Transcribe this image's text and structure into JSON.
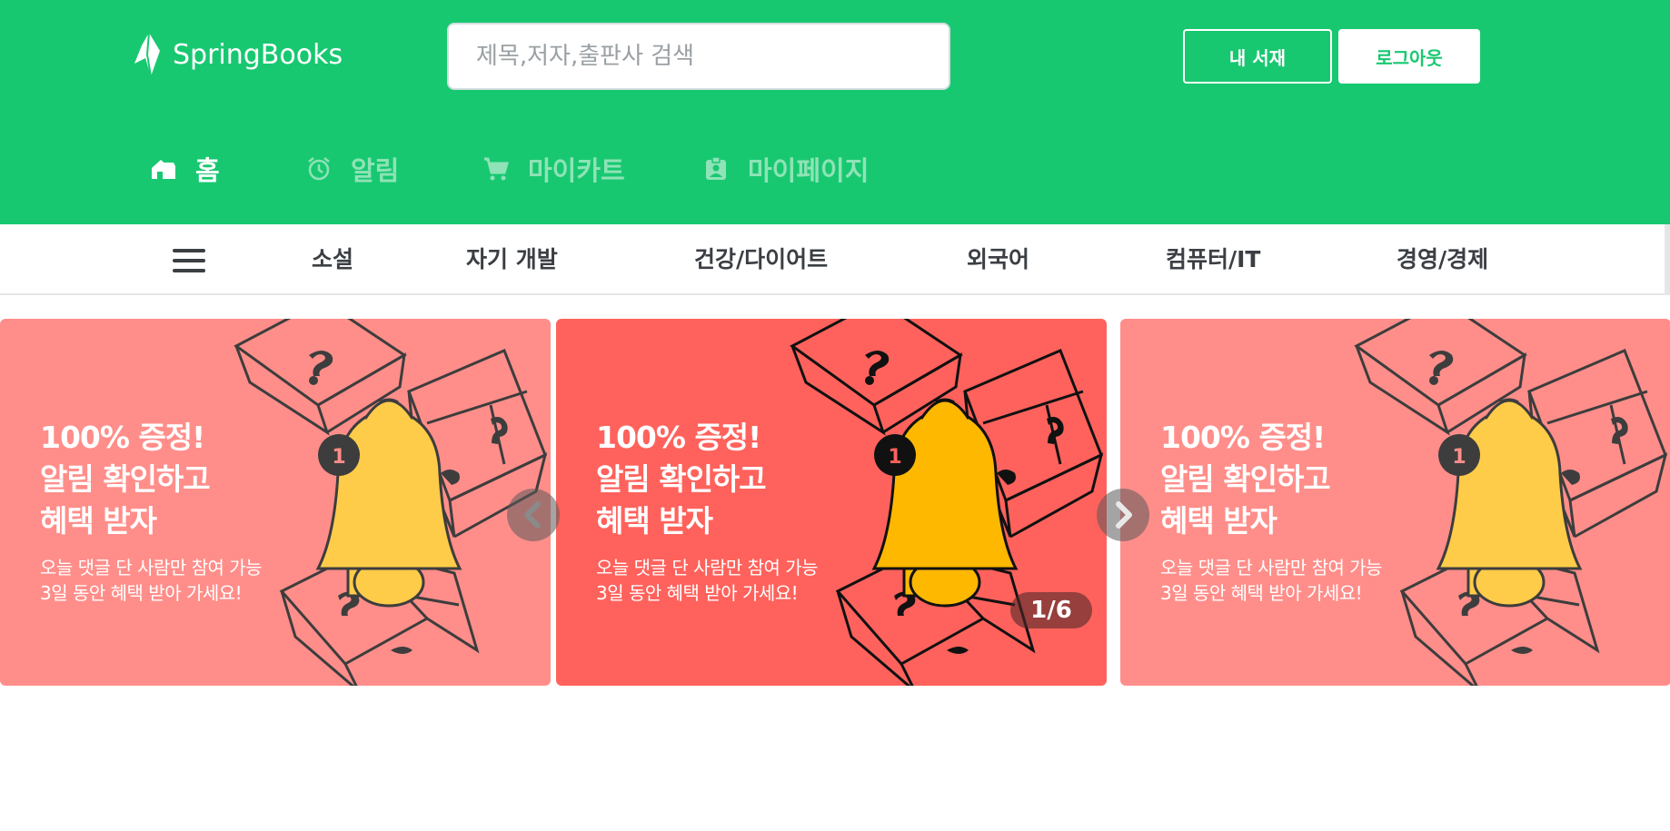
{
  "header": {
    "logo_text": "SpringBooks",
    "search_placeholder": "제목,저자,출판사 검색",
    "shelf_label": "내 서재",
    "logout_label": "로그아웃",
    "brand_color": "#18c871"
  },
  "nav": [
    {
      "label": "홈",
      "icon": "home-icon",
      "active": true
    },
    {
      "label": "알림",
      "icon": "alarm-clock-icon",
      "active": false
    },
    {
      "label": "마이카트",
      "icon": "cart-icon",
      "active": false
    },
    {
      "label": "마이페이지",
      "icon": "id-badge-icon",
      "active": false
    }
  ],
  "categories": [
    "소설",
    "자기 개발",
    "건강/다이어트",
    "외국어",
    "컴퓨터/IT",
    "경영/경제"
  ],
  "banner": {
    "title": "100% 증정!\n알림 확인하고\n혜택 받자",
    "subtitle": "오늘 댓글 단 사람만 참여 가능\n3일 동안 혜택 받아 가세요!",
    "badge_number": "1",
    "counter": "1/6",
    "side_color": "#ff8e8a",
    "center_color": "#ff625c"
  }
}
